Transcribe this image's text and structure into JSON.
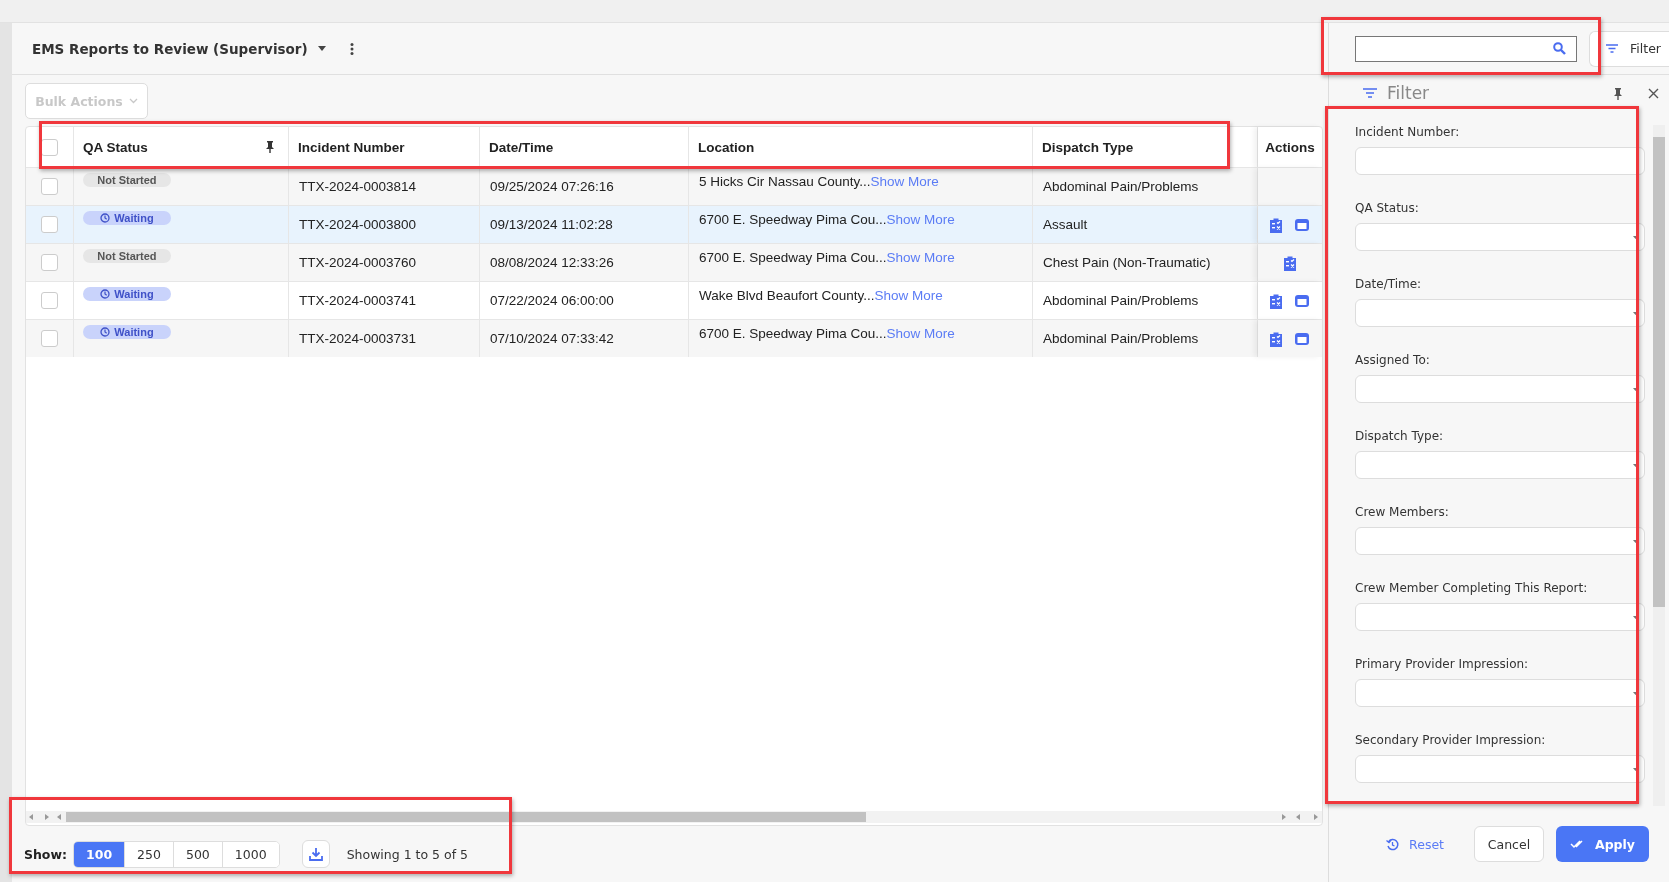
{
  "header": {
    "title": "EMS Reports to Review (Supervisor)"
  },
  "bulk_actions": {
    "label": "Bulk Actions",
    "disabled": true
  },
  "search": {
    "highlighted": true
  },
  "filter_button": {
    "label": "Filter"
  },
  "table": {
    "header_highlighted": true,
    "columns": [
      "QA Status",
      "Incident Number",
      "Date/Time",
      "Location",
      "Dispatch Type"
    ],
    "actions_column": "Actions",
    "all_checked": false,
    "rows": [
      {
        "checked": false,
        "hovered": false,
        "status": "Not Started",
        "kind": "not_started",
        "incident": "TTX-2024-0003814",
        "datetime": "09/25/2024 07:26:16",
        "location": "5 Hicks Cir Nassau County...",
        "location_link": "Show More",
        "dispatch": "Abdominal Pain/Problems",
        "actions": []
      },
      {
        "checked": false,
        "hovered": true,
        "status": "Waiting",
        "kind": "waiting",
        "incident": "TTX-2024-0003800",
        "datetime": "09/13/2024 11:02:28",
        "location": "6700 E. Speedway Pima Cou...",
        "location_link": "Show More",
        "dispatch": "Assault",
        "actions": [
          {
            "kind": "review"
          },
          {
            "kind": "print"
          }
        ]
      },
      {
        "checked": false,
        "hovered": false,
        "status": "Not Started",
        "kind": "not_started",
        "incident": "TTX-2024-0003760",
        "datetime": "08/08/2024 12:33:26",
        "location": "6700 E. Speedway Pima Cou...",
        "location_link": "Show More",
        "dispatch": "Chest Pain (Non-Traumatic)",
        "actions": [
          {
            "kind": "review"
          }
        ]
      },
      {
        "checked": false,
        "hovered": false,
        "status": "Waiting",
        "kind": "waiting",
        "incident": "TTX-2024-0003741",
        "datetime": "07/22/2024 06:00:00",
        "location": "Wake Blvd Beaufort County...",
        "location_link": "Show More",
        "dispatch": "Abdominal Pain/Problems",
        "actions": [
          {
            "kind": "review"
          },
          {
            "kind": "print"
          }
        ]
      },
      {
        "checked": false,
        "hovered": false,
        "status": "Waiting",
        "kind": "waiting",
        "incident": "TTX-2024-0003731",
        "datetime": "07/10/2024 07:33:42",
        "location": "6700 E. Speedway Pima Cou...",
        "location_link": "Show More",
        "dispatch": "Abdominal Pain/Problems",
        "actions": [
          {
            "kind": "review"
          },
          {
            "kind": "print"
          }
        ]
      }
    ]
  },
  "footer": {
    "highlighted": true,
    "show_label": "Show:",
    "page_sizes": [
      {
        "label": "100",
        "selected": true
      },
      {
        "label": "250",
        "selected": false
      },
      {
        "label": "500",
        "selected": false
      },
      {
        "label": "1000",
        "selected": false
      }
    ],
    "status": "Showing 1 to 5 of 5"
  },
  "filter_panel": {
    "highlighted": true,
    "title": "Filter",
    "fields": [
      {
        "label": "Incident Number:",
        "kind": "text"
      },
      {
        "label": "QA Status:",
        "kind": "select"
      },
      {
        "label": "Date/Time:",
        "kind": "select"
      },
      {
        "label": "Assigned To:",
        "kind": "select"
      },
      {
        "label": "Dispatch Type:",
        "kind": "select"
      },
      {
        "label": "Crew Members:",
        "kind": "select"
      },
      {
        "label": "Crew Member Completing This Report:",
        "kind": "select"
      },
      {
        "label": "Primary Provider Impression:",
        "kind": "select"
      },
      {
        "label": "Secondary Provider Impression:",
        "kind": "select"
      }
    ],
    "buttons": [
      {
        "label": "Reset",
        "kind": "reset"
      },
      {
        "label": "Cancel",
        "kind": "cancel"
      },
      {
        "label": "Apply",
        "kind": "apply"
      }
    ]
  }
}
